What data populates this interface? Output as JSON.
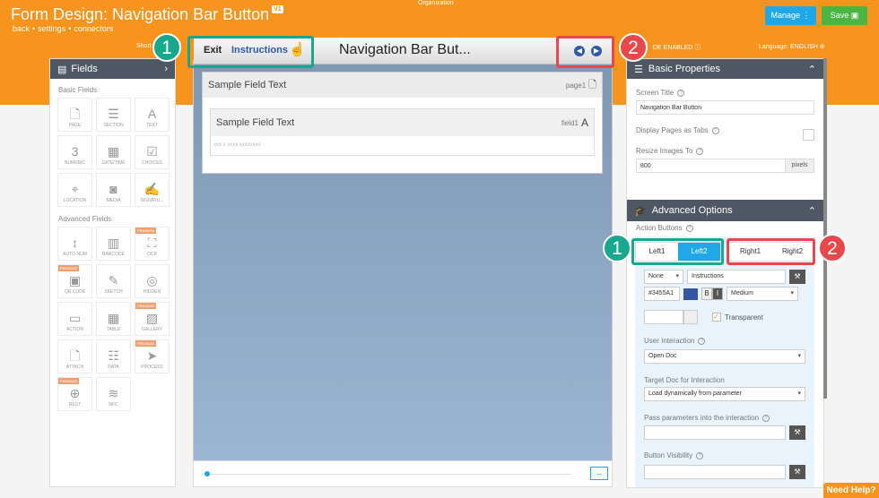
{
  "header": {
    "title": "Form Design: Navigation Bar Button",
    "version": "V1",
    "breadcrumbs": [
      "back",
      "settings",
      "connectors"
    ],
    "org_label": "Organization",
    "manage_label": "Manage",
    "save_label": "Save",
    "shortcut_label": "Short",
    "mode_label": "DE ENABLED",
    "language_label": "Language: ENGLISH"
  },
  "fields_panel": {
    "title": "Fields",
    "basic_heading": "Basic Fields",
    "advanced_heading": "Advanced Fields",
    "premium_label": "PREMIUM",
    "basic": [
      {
        "label": "PAGE",
        "icon": "page-icon"
      },
      {
        "label": "SECTION",
        "icon": "section-icon"
      },
      {
        "label": "TEXT",
        "icon": "text-icon"
      },
      {
        "label": "NUMERIC",
        "icon": "numeric-icon"
      },
      {
        "label": "DATE/TIME",
        "icon": "calendar-icon"
      },
      {
        "label": "CHOICES",
        "icon": "checkbox-icon"
      },
      {
        "label": "LOCATION",
        "icon": "location-pin-icon"
      },
      {
        "label": "MEDIA",
        "icon": "camera-icon"
      },
      {
        "label": "SIGNATU...",
        "icon": "signature-icon"
      }
    ],
    "advanced": [
      {
        "label": "AUTO-NUM",
        "icon": "auto-number-icon",
        "premium": false
      },
      {
        "label": "BARCODE",
        "icon": "barcode-icon",
        "premium": false
      },
      {
        "label": "OCR",
        "icon": "ocr-icon",
        "premium": true
      },
      {
        "label": "QR CODE",
        "icon": "qr-code-icon",
        "premium": true
      },
      {
        "label": "SKETCH",
        "icon": "sketch-icon",
        "premium": false
      },
      {
        "label": "HIDDEN",
        "icon": "eye-slash-icon",
        "premium": false
      },
      {
        "label": "ACTION",
        "icon": "action-icon",
        "premium": false
      },
      {
        "label": "TABLE",
        "icon": "table-icon",
        "premium": false
      },
      {
        "label": "GALLERY",
        "icon": "gallery-icon",
        "premium": true
      },
      {
        "label": "ATTACH",
        "icon": "attach-icon",
        "premium": false
      },
      {
        "label": "DATA",
        "icon": "database-icon",
        "premium": false
      },
      {
        "label": "PROCESS",
        "icon": "send-icon",
        "premium": true
      },
      {
        "label": "REST",
        "icon": "globe-icon",
        "premium": true
      },
      {
        "label": "NFC",
        "icon": "nfc-icon",
        "premium": false
      }
    ]
  },
  "canvas": {
    "nav_exit": "Exit",
    "nav_instructions": "Instructions",
    "nav_title": "Navigation Bar But...",
    "page_title": "Sample Field Text",
    "page_tag": "page1",
    "field_title": "Sample Field Text",
    "field_tag": "field1",
    "field_placeholder": "xxx x xxxx xxxxxxxx"
  },
  "basic_properties": {
    "title": "Basic Properties",
    "screen_title_label": "Screen Title",
    "screen_title_value": "Navigation Bar Button",
    "display_tabs_label": "Display Pages as Tabs",
    "resize_label": "Resize Images To",
    "resize_value": "800",
    "resize_unit": "pixels"
  },
  "advanced_options": {
    "title": "Advanced Options",
    "action_buttons_label": "Action Buttons",
    "left_tabs": [
      "Left1",
      "Left2"
    ],
    "right_tabs": [
      "Right1",
      "Right2"
    ],
    "button_type": "None",
    "button_text": "Instructions",
    "color_hex": "#3455A1",
    "bold_label": "B",
    "italic_label": "I",
    "font_size": "Medium",
    "transparent_label": "Transparent",
    "user_interaction_label": "User Interaction",
    "user_interaction_value": "Open Doc",
    "target_doc_label": "Target Doc for Interaction",
    "target_doc_value": "Load dynamically from parameter",
    "pass_params_label": "Pass parameters into the interaction",
    "visibility_label": "Button Visibility"
  },
  "callouts": {
    "one": "1",
    "two": "2"
  },
  "help_label": "Need Help?",
  "colors": {
    "brand": "#f7941d",
    "accent": "#1fa7e8",
    "swatch": "#3455a1"
  }
}
